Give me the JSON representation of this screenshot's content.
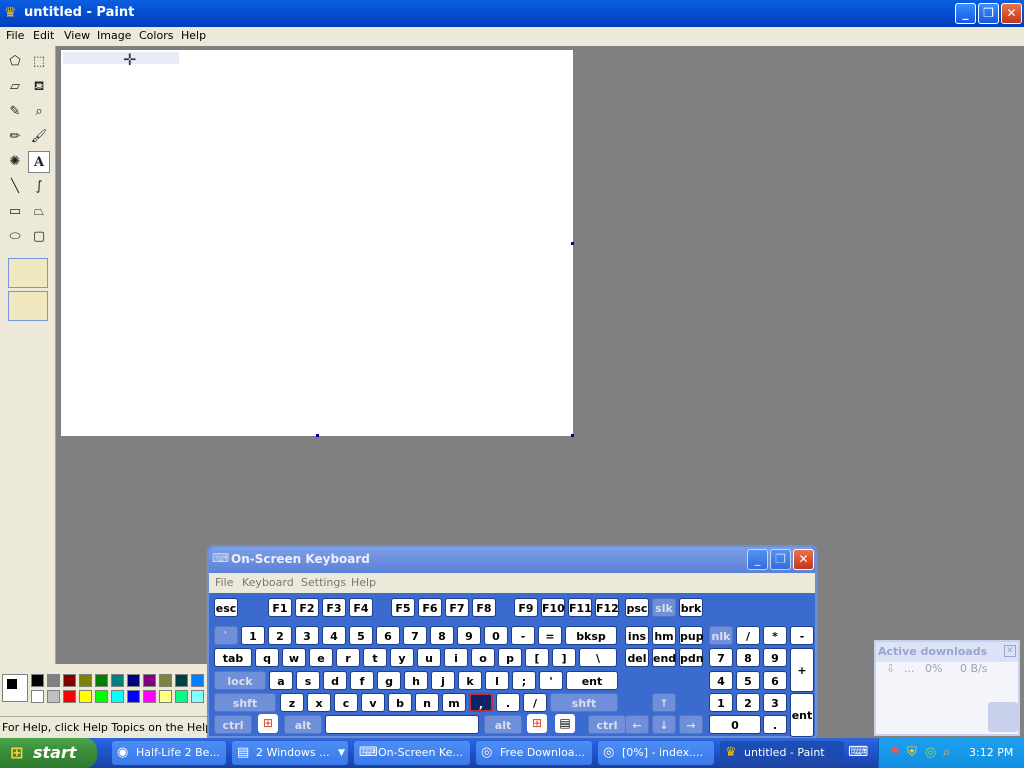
{
  "window": {
    "title": "untitled - Paint"
  },
  "menu": [
    "File",
    "Edit",
    "View",
    "Image",
    "Colors",
    "Help"
  ],
  "tools": [
    "free-select",
    "rect-select",
    "eraser",
    "fill",
    "color-picker",
    "magnifier",
    "pencil",
    "brush",
    "airbrush",
    "text",
    "line",
    "curve",
    "rectangle",
    "polygon",
    "ellipse",
    "rounded-rect"
  ],
  "text_tool_label": "A",
  "palette_colors": [
    "#000000",
    "#808080",
    "#800000",
    "#808000",
    "#008000",
    "#008080",
    "#000080",
    "#800080",
    "#808040",
    "#004040",
    "#0080ff",
    "#ffffff",
    "#c0c0c0",
    "#ff0000",
    "#ffff00",
    "#00ff00",
    "#00ffff",
    "#0000ff",
    "#ff00ff",
    "#ffff80",
    "#00ff80",
    "#80ffff"
  ],
  "status": {
    "text": "For Help, click Help Topics on the Help Menu."
  },
  "osk": {
    "title": "On-Screen Keyboard",
    "menu": [
      "File",
      "Keyboard",
      "Settings",
      "Help"
    ],
    "rows": {
      "r1": [
        "esc",
        "F1",
        "F2",
        "F3",
        "F4",
        "F5",
        "F6",
        "F7",
        "F8",
        "F9",
        "F10",
        "F11",
        "F12",
        "psc",
        "slk",
        "brk"
      ],
      "r2": [
        "`",
        "1",
        "2",
        "3",
        "4",
        "5",
        "6",
        "7",
        "8",
        "9",
        "0",
        "-",
        "=",
        "bksp",
        "ins",
        "hm",
        "pup",
        "nlk",
        "/",
        "*",
        "-"
      ],
      "r3": [
        "tab",
        "q",
        "w",
        "e",
        "r",
        "t",
        "y",
        "u",
        "i",
        "o",
        "p",
        "[",
        "]",
        "\\",
        "del",
        "end",
        "pdn",
        "7",
        "8",
        "9",
        "+"
      ],
      "r4": [
        "lock",
        "a",
        "s",
        "d",
        "f",
        "g",
        "h",
        "j",
        "k",
        "l",
        ";",
        "'",
        "ent",
        "4",
        "5",
        "6"
      ],
      "r5": [
        "shft",
        "z",
        "x",
        "c",
        "v",
        "b",
        "n",
        "m",
        ",",
        ".",
        "/",
        "shft",
        "↑",
        "1",
        "2",
        "3",
        "ent"
      ],
      "r6": [
        "ctrl",
        "alt",
        "alt",
        "ctrl",
        "←",
        "↓",
        "→",
        "0",
        "."
      ]
    }
  },
  "downloads": {
    "title": "Active downloads",
    "row": {
      "dots": "...",
      "percent": "0%",
      "speed": "0 B/s"
    }
  },
  "taskbar": {
    "start": "start",
    "items": [
      "Half-Life 2 Be...",
      "2 Windows ...",
      "On-Screen Ke...",
      "Free Downloa...",
      "[0%] - index....",
      "untitled - Paint"
    ],
    "clock": "3:12 PM"
  }
}
